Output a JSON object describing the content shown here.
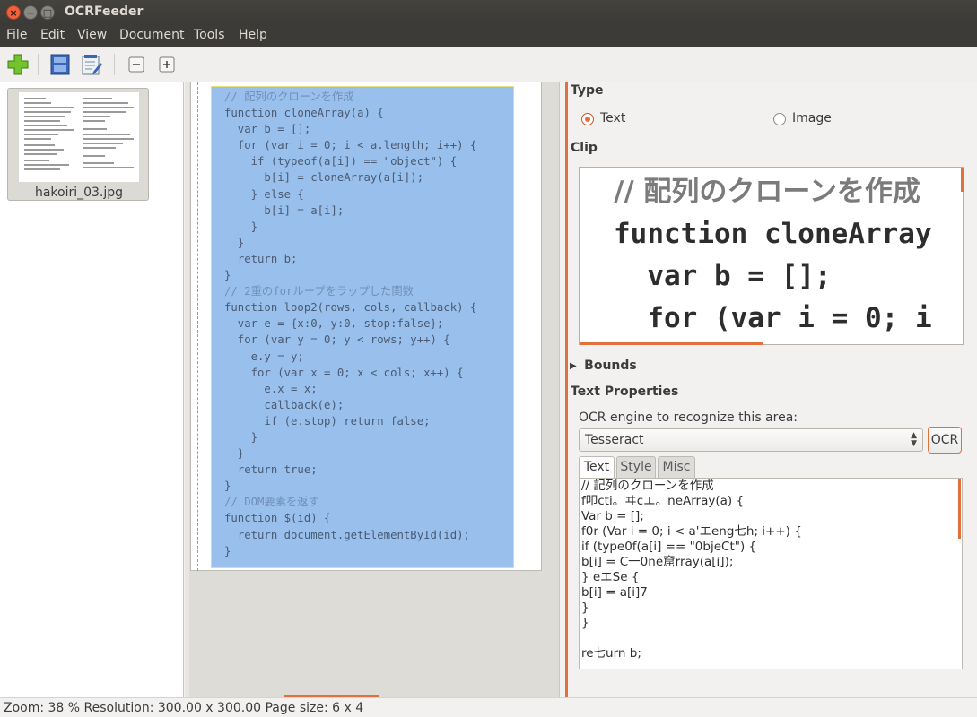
{
  "window": {
    "title": "OCRFeeder"
  },
  "menu": [
    "File",
    "Edit",
    "View",
    "Document",
    "Tools",
    "Help"
  ],
  "toolbar": {
    "buttons": [
      "add-image-icon",
      "page-layout-icon",
      "edit-text-icon",
      "zoom-out-icon",
      "zoom-in-icon"
    ]
  },
  "pages": [
    {
      "name": "hakoiri_03.jpg"
    }
  ],
  "document_code": [
    {
      "t": "// 配列のクローンを作成",
      "c": true
    },
    {
      "t": "function cloneArray(a) {"
    },
    {
      "t": "  var b = [];"
    },
    {
      "t": "  for (var i = 0; i < a.length; i++) {"
    },
    {
      "t": "    if (typeof(a[i]) == \"object\") {"
    },
    {
      "t": "      b[i] = cloneArray(a[i]);"
    },
    {
      "t": "    } else {"
    },
    {
      "t": "      b[i] = a[i];"
    },
    {
      "t": "    }"
    },
    {
      "t": "  }"
    },
    {
      "t": "  return b;"
    },
    {
      "t": "}"
    },
    {
      "t": "// 2重のforループをラップした関数",
      "c": true
    },
    {
      "t": "function loop2(rows, cols, callback) {"
    },
    {
      "t": "  var e = {x:0, y:0, stop:false};"
    },
    {
      "t": "  for (var y = 0; y < rows; y++) {"
    },
    {
      "t": "    e.y = y;"
    },
    {
      "t": "    for (var x = 0; x < cols; x++) {"
    },
    {
      "t": "      e.x = x;"
    },
    {
      "t": "      callback(e);"
    },
    {
      "t": "      if (e.stop) return false;"
    },
    {
      "t": "    }"
    },
    {
      "t": "  }"
    },
    {
      "t": "  return true;"
    },
    {
      "t": "}"
    },
    {
      "t": "// DOM要素を返す",
      "c": true
    },
    {
      "t": "function $(id) {"
    },
    {
      "t": "  return document.getElementById(id);"
    },
    {
      "t": "}"
    }
  ],
  "properties": {
    "type_heading": "Type",
    "type_text": "Text",
    "type_image": "Image",
    "type_selected": "Text",
    "clip_heading": "Clip",
    "clip_lines": [
      "// 配列のクローンを作成",
      "function cloneArray",
      "  var b = [];",
      "  for (var i = 0; i"
    ],
    "bounds_heading": "Bounds",
    "text_props_heading": "Text Properties",
    "ocr_engine_label": "OCR engine to recognize this area:",
    "ocr_engine_value": "Tesseract",
    "ocr_button": "OCR",
    "tabs": [
      "Text",
      "Style",
      "Misc"
    ],
    "active_tab": "Text",
    "ocr_text": "// 記列のクローンを作成\nf叩cti。ヰcエ。neArray(a) {\nVar b = [];\nf0r (Var i = 0; i < a'エeng七h; i++) {\nif (type0f(a[i] == \"0bjeCt\") {\nb[i] = C一0ne窟rray(a[i]);\n} eエSe {\nb[i] = a[i]7\n}\n}\n\nre七urn b;"
  },
  "status": "Zoom: 38 % Resolution: 300.00 x 300.00 Page size: 6 x 4",
  "colors": {
    "accent": "#e0703e",
    "selection": "#99c0ec",
    "titlebar": "#3c3b37"
  }
}
